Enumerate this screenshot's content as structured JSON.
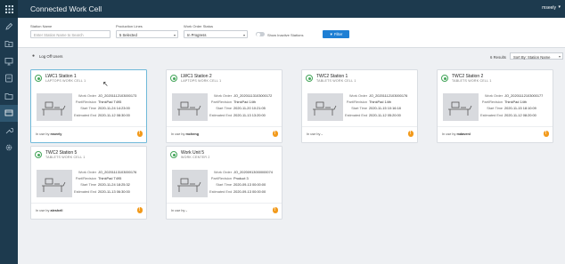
{
  "app": {
    "title": "Connected Work Cell",
    "user": "mseely"
  },
  "sidebar": {
    "items": [
      {
        "icon": "pencil-icon"
      },
      {
        "icon": "folder-add-icon"
      },
      {
        "icon": "monitor-icon"
      },
      {
        "icon": "tablet-icon"
      },
      {
        "icon": "folder-icon"
      },
      {
        "icon": "station-icon",
        "active": true
      },
      {
        "icon": "tools-icon"
      },
      {
        "icon": "gear-icon"
      }
    ]
  },
  "filters": {
    "station_name": {
      "label": "Station Name",
      "placeholder": "Enter Station Name to Search"
    },
    "production_lines": {
      "label": "Production Lines",
      "value": "5 Selected"
    },
    "work_order_status": {
      "label": "Work Order Status",
      "value": "In Progress"
    },
    "show_inactive_label": "Show Inactive Stations",
    "filter_button": "Filter"
  },
  "toolbar": {
    "logoff_label": "Log Off Users",
    "results": "6 Results",
    "sort_value": "Sort By: Station Name"
  },
  "field_labels": {
    "work_order": "Work Order",
    "part_revision": "Part/Revision",
    "start_time": "Start Time",
    "estimated_end": "Estimated End"
  },
  "stations": [
    {
      "name": "LWC1 Station 1",
      "cell": "LAPTOPS WORK CELL 1",
      "work_order": "JO_20201112103000173",
      "part": "ThinkPad T495",
      "start": "2020-11-24 14:23:00",
      "end": "2020-11-12 08:30:00",
      "in_use_by": "mseely"
    },
    {
      "name": "LWC1 Station 2",
      "cell": "LAPTOPS WORK CELL 1",
      "work_order": "JO_20201113103000172",
      "part": "ThinkPad 14th",
      "start": "2020-11-20 10:21:05",
      "end": "2020-11-13 13:20:00",
      "in_use_by": "mcheng"
    },
    {
      "name": "TWC2 Station 1",
      "cell": "TABLETS WORK CELL 1",
      "work_order": "JO_20201112103000176",
      "part": "ThinkPad 14th",
      "start": "2020-11-15 10:16:18",
      "end": "2020-11-12 05:20:00",
      "in_use_by": "-"
    },
    {
      "name": "TWC2 Station 2",
      "cell": "TABLETS WORK CELL 1",
      "work_order": "JO_20201112103000177",
      "part": "ThinkPad 14th",
      "start": "2020-11-15 18:10:09",
      "end": "2020-11-12 08:20:00",
      "in_use_by": "mdavenl"
    },
    {
      "name": "TWC2 Station 5",
      "cell": "TABLETS WORK CELL 1",
      "work_order": "JO_20201113103000176",
      "part": "ThinkPad T495",
      "start": "2020-11-24 18:25:32",
      "end": "2020-11-13 06:30:00",
      "in_use_by": "aleshell"
    },
    {
      "name": "Work Unit 5",
      "cell": "WORK CENTER 2",
      "work_order": "JO_20200913000000074",
      "part": "Product 3",
      "start": "2020-09-13 00:00:00",
      "end": "2020-09-13 00:00:00",
      "in_use_by": "-"
    }
  ],
  "in_use_prefix": "In use by"
}
